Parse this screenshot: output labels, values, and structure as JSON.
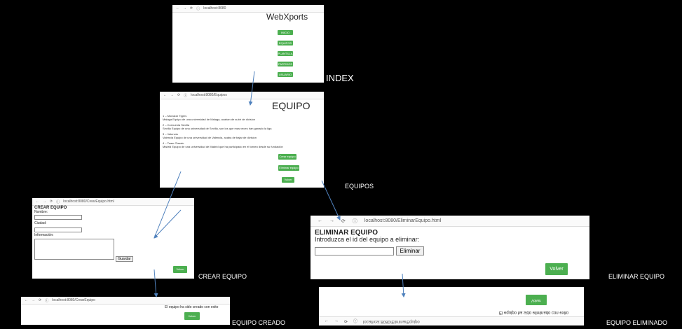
{
  "index": {
    "url": "localhost:8080",
    "title": "WebXports",
    "buttons": [
      "INICIO",
      "EQUIPOS",
      "PLANTILLA",
      "PARTIDOS",
      "USUARIO"
    ],
    "caption": "INDEX"
  },
  "equipos": {
    "url": "localhost:8080/Equipos",
    "title": "EQUIPO",
    "teams": [
      {
        "head": "1 – Moralzar Tigers",
        "desc": "Malaga Equipo de una universidad de Malaga, acaban de subir de division"
      },
      {
        "head": "2 – Cornuenia Sevilla",
        "desc": "Sevilla Equipo de una universidad de Sevilla, son los que mas veces han ganado la liga"
      },
      {
        "head": "3 – Valencia",
        "desc": "Valencia Equipo de una universidad de Valencia, acaba de bajar de division"
      },
      {
        "head": "4 – Team Classic",
        "desc": "Madrid Equipo de una universidad de Madrid que ha participado en el torneo desde su fundación"
      }
    ],
    "buttons": [
      "Crear equipo",
      "Eliminar equipo",
      "Volver"
    ],
    "caption": "EQUIPOS"
  },
  "crear": {
    "url": "localhost:8080/CrearEquipo.html",
    "heading": "CREAR EQUIPO",
    "nombre_label": "Nombre:",
    "ciudad_label": "Ciudad:",
    "info_label": "Información:",
    "guardar_label": "Guardar",
    "volver_label": "Volver",
    "caption": "CREAR EQUIPO"
  },
  "creado": {
    "url": "localhost:8080/CrearEquipo",
    "message": "El equipo ha sido creado con exito",
    "volver_label": "Volver",
    "caption": "EQUIPO CREADO"
  },
  "eliminar": {
    "url": "localhost:8080/EliminarEquipo.html",
    "heading": "ELIMINAR EQUIPO",
    "prompt": "Introduzca el id del equipo a eliminar:",
    "eliminar_label": "Eliminar",
    "volver_label": "Volver",
    "caption": "ELIMINAR EQUIPO"
  },
  "eliminado": {
    "url": "localhost:8080/EliminarEquipo",
    "message": "El equipo ha sido eliminado con exito",
    "volver_label": "Volver",
    "caption": "EQUIPO ELIMINADO"
  },
  "colors": {
    "button_green": "#4caf50",
    "arrow_blue": "#4f81bd",
    "background": "#000000"
  }
}
